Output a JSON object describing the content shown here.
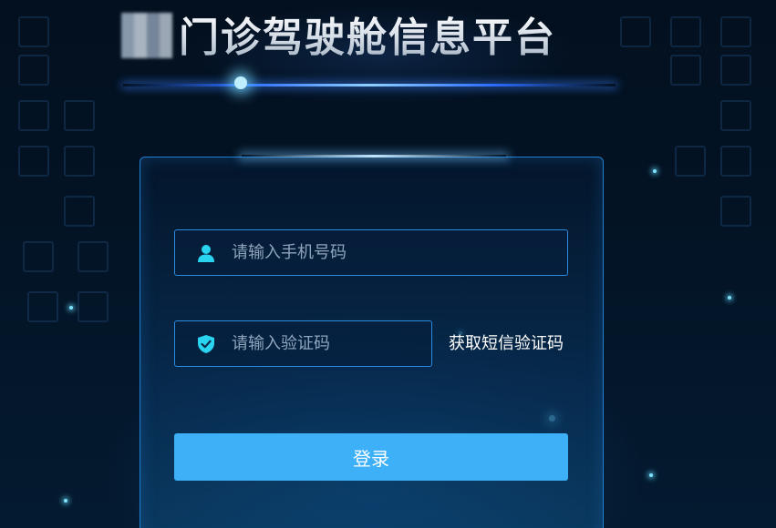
{
  "header": {
    "title": "门诊驾驶舱信息平台",
    "logo_icon": "hospital-logo-icon"
  },
  "login": {
    "phone_placeholder": "请输入手机号码",
    "phone_icon": "user-icon",
    "code_placeholder": "请输入验证码",
    "code_icon": "shield-check-icon",
    "get_code_label": "获取短信验证码",
    "submit_label": "登录"
  },
  "colors": {
    "accent": "#3eb0f8",
    "icon": "#28d4f0",
    "background": "#020c18",
    "border": "#2a8be0"
  }
}
